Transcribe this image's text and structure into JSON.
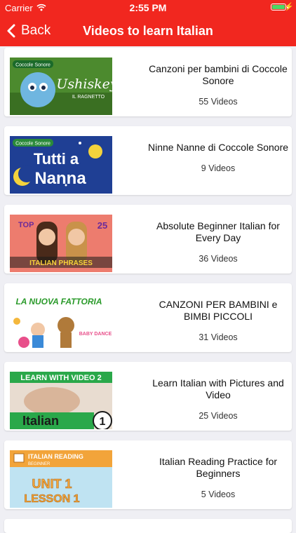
{
  "status": {
    "carrier": "Carrier",
    "time": "2:55 PM"
  },
  "nav": {
    "back_label": "Back",
    "title": "Videos to learn Italian"
  },
  "playlists": [
    {
      "title": "Canzoni per bambini di Coccole Sonore",
      "count": "55 Videos",
      "thumb": {
        "badge": "Coccole Sonore",
        "line1": "Ushiskey",
        "line2": "IL RAGNETTO"
      }
    },
    {
      "title": "Ninne Nanne di Coccole Sonore",
      "count": "9 Videos",
      "thumb": {
        "badge": "Coccole Sonore",
        "line1": "Tutti a",
        "line2": "Nanna"
      }
    },
    {
      "title": "Absolute Beginner Italian for Every Day",
      "count": "36 Videos",
      "thumb": {
        "badge": "TOP",
        "line1": "25",
        "line2": "ITALIAN PHRASES"
      }
    },
    {
      "title": "CANZONI PER BAMBINI e BIMBI PICCOLI",
      "count": "31 Videos",
      "thumb": {
        "badge": "LA NUOVA FATTORIA",
        "line1": "BABY DANCE",
        "line2": ""
      }
    },
    {
      "title": "Learn Italian with Pictures and Video",
      "count": "25 Videos",
      "thumb": {
        "badge": "LEARN WITH VIDEO 2",
        "line1": "Italian",
        "line2": "1"
      }
    },
    {
      "title": "Italian Reading Practice for Beginners",
      "count": "5 Videos",
      "thumb": {
        "badge": "ITALIAN READING",
        "line1": "BEGINNER",
        "line2": "UNIT 1",
        "line3": "LESSON 1"
      }
    }
  ]
}
